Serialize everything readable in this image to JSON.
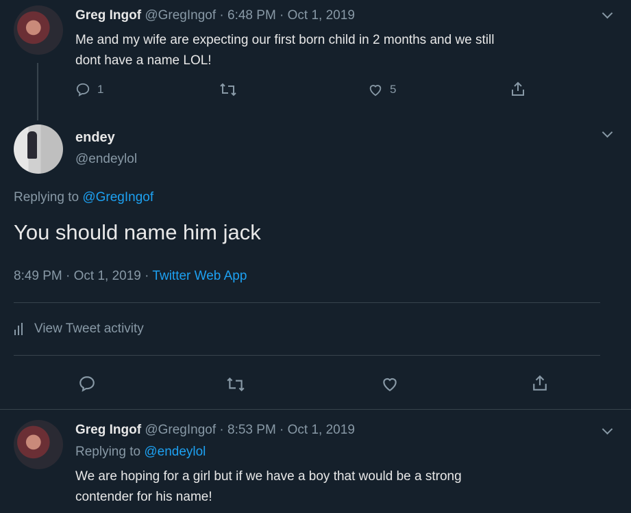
{
  "tweet1": {
    "name": "Greg Ingof",
    "handle_time": "@GregIngof · 6:48 PM · Oct 1, 2019",
    "text_line1": "Me and my wife are expecting our first born child in 2 months and we still",
    "text_line2": "dont have a name LOL!",
    "reply_count": "1",
    "like_count": "5"
  },
  "tweet2": {
    "name": "endey",
    "handle": "@endeylol",
    "replying_prefix": "Replying to ",
    "replying_handle": "@GregIngof",
    "text": "You should name him jack",
    "timestamp": "8:49 PM · Oct 1, 2019 · ",
    "source": "Twitter Web App",
    "activity_label": "View Tweet activity"
  },
  "tweet3": {
    "name": "Greg Ingof",
    "handle_time": "@GregIngof · 8:53 PM · Oct 1, 2019",
    "replying_prefix": "Replying to ",
    "replying_handle": "@endeylol",
    "text_line1": "We are hoping for a girl but if we have a boy that would be a strong",
    "text_line2": "contender for his name!"
  },
  "colors": {
    "background": "#15202b",
    "accent": "#1da1f2",
    "muted": "#8899a6"
  }
}
